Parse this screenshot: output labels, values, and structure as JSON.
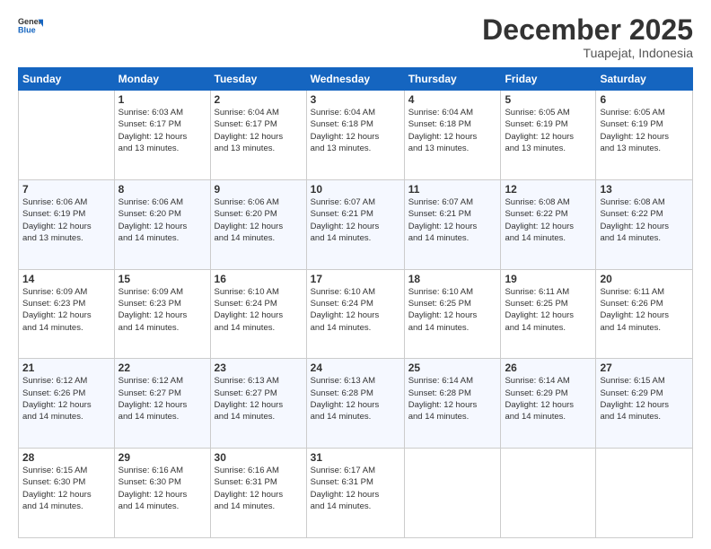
{
  "logo": {
    "line1": "General",
    "line2": "Blue"
  },
  "title": "December 2025",
  "subtitle": "Tuapejat, Indonesia",
  "days_header": [
    "Sunday",
    "Monday",
    "Tuesday",
    "Wednesday",
    "Thursday",
    "Friday",
    "Saturday"
  ],
  "weeks": [
    [
      {
        "day": "",
        "info": ""
      },
      {
        "day": "1",
        "info": "Sunrise: 6:03 AM\nSunset: 6:17 PM\nDaylight: 12 hours\nand 13 minutes."
      },
      {
        "day": "2",
        "info": "Sunrise: 6:04 AM\nSunset: 6:17 PM\nDaylight: 12 hours\nand 13 minutes."
      },
      {
        "day": "3",
        "info": "Sunrise: 6:04 AM\nSunset: 6:18 PM\nDaylight: 12 hours\nand 13 minutes."
      },
      {
        "day": "4",
        "info": "Sunrise: 6:04 AM\nSunset: 6:18 PM\nDaylight: 12 hours\nand 13 minutes."
      },
      {
        "day": "5",
        "info": "Sunrise: 6:05 AM\nSunset: 6:19 PM\nDaylight: 12 hours\nand 13 minutes."
      },
      {
        "day": "6",
        "info": "Sunrise: 6:05 AM\nSunset: 6:19 PM\nDaylight: 12 hours\nand 13 minutes."
      }
    ],
    [
      {
        "day": "7",
        "info": ""
      },
      {
        "day": "8",
        "info": "Sunrise: 6:06 AM\nSunset: 6:20 PM\nDaylight: 12 hours\nand 14 minutes."
      },
      {
        "day": "9",
        "info": "Sunrise: 6:06 AM\nSunset: 6:20 PM\nDaylight: 12 hours\nand 14 minutes."
      },
      {
        "day": "10",
        "info": "Sunrise: 6:07 AM\nSunset: 6:21 PM\nDaylight: 12 hours\nand 14 minutes."
      },
      {
        "day": "11",
        "info": "Sunrise: 6:07 AM\nSunset: 6:21 PM\nDaylight: 12 hours\nand 14 minutes."
      },
      {
        "day": "12",
        "info": "Sunrise: 6:08 AM\nSunset: 6:22 PM\nDaylight: 12 hours\nand 14 minutes."
      },
      {
        "day": "13",
        "info": "Sunrise: 6:08 AM\nSunset: 6:22 PM\nDaylight: 12 hours\nand 14 minutes."
      }
    ],
    [
      {
        "day": "14",
        "info": ""
      },
      {
        "day": "15",
        "info": "Sunrise: 6:09 AM\nSunset: 6:23 PM\nDaylight: 12 hours\nand 14 minutes."
      },
      {
        "day": "16",
        "info": "Sunrise: 6:10 AM\nSunset: 6:24 PM\nDaylight: 12 hours\nand 14 minutes."
      },
      {
        "day": "17",
        "info": "Sunrise: 6:10 AM\nSunset: 6:24 PM\nDaylight: 12 hours\nand 14 minutes."
      },
      {
        "day": "18",
        "info": "Sunrise: 6:10 AM\nSunset: 6:25 PM\nDaylight: 12 hours\nand 14 minutes."
      },
      {
        "day": "19",
        "info": "Sunrise: 6:11 AM\nSunset: 6:25 PM\nDaylight: 12 hours\nand 14 minutes."
      },
      {
        "day": "20",
        "info": "Sunrise: 6:11 AM\nSunset: 6:26 PM\nDaylight: 12 hours\nand 14 minutes."
      }
    ],
    [
      {
        "day": "21",
        "info": ""
      },
      {
        "day": "22",
        "info": "Sunrise: 6:12 AM\nSunset: 6:27 PM\nDaylight: 12 hours\nand 14 minutes."
      },
      {
        "day": "23",
        "info": "Sunrise: 6:13 AM\nSunset: 6:27 PM\nDaylight: 12 hours\nand 14 minutes."
      },
      {
        "day": "24",
        "info": "Sunrise: 6:13 AM\nSunset: 6:28 PM\nDaylight: 12 hours\nand 14 minutes."
      },
      {
        "day": "25",
        "info": "Sunrise: 6:14 AM\nSunset: 6:28 PM\nDaylight: 12 hours\nand 14 minutes."
      },
      {
        "day": "26",
        "info": "Sunrise: 6:14 AM\nSunset: 6:29 PM\nDaylight: 12 hours\nand 14 minutes."
      },
      {
        "day": "27",
        "info": "Sunrise: 6:15 AM\nSunset: 6:29 PM\nDaylight: 12 hours\nand 14 minutes."
      }
    ],
    [
      {
        "day": "28",
        "info": ""
      },
      {
        "day": "29",
        "info": "Sunrise: 6:16 AM\nSunset: 6:30 PM\nDaylight: 12 hours\nand 14 minutes."
      },
      {
        "day": "30",
        "info": "Sunrise: 6:16 AM\nSunset: 6:31 PM\nDaylight: 12 hours\nand 14 minutes."
      },
      {
        "day": "31",
        "info": "Sunrise: 6:17 AM\nSunset: 6:31 PM\nDaylight: 12 hours\nand 14 minutes."
      },
      {
        "day": "",
        "info": ""
      },
      {
        "day": "",
        "info": ""
      },
      {
        "day": "",
        "info": ""
      }
    ]
  ],
  "week1_day7_info": "Sunrise: 6:06 AM\nSunset: 6:19 PM\nDaylight: 12 hours\nand 13 minutes.",
  "week2_day14_info": "Sunrise: 6:09 AM\nSunset: 6:23 PM\nDaylight: 12 hours\nand 14 minutes.",
  "week3_day21_info": "Sunrise: 6:12 AM\nSunset: 6:26 PM\nDaylight: 12 hours\nand 14 minutes.",
  "week4_day28_info": "Sunrise: 6:15 AM\nSunset: 6:30 PM\nDaylight: 12 hours\nand 14 minutes."
}
